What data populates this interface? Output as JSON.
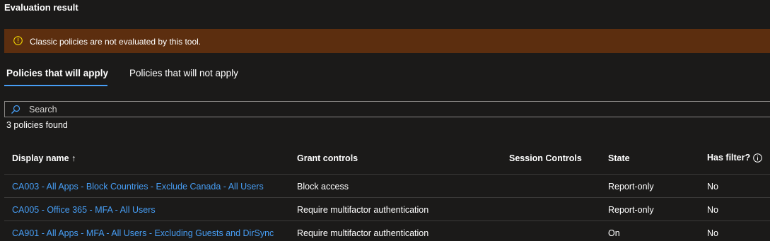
{
  "header": {
    "title": "Evaluation result"
  },
  "warning": {
    "icon": "info-icon",
    "message": "Classic policies are not evaluated by this tool.",
    "background": "#5c2e0f",
    "icon_color": "#fce100"
  },
  "tabs": [
    {
      "label": "Policies that will apply",
      "active": true
    },
    {
      "label": "Policies that will not apply",
      "active": false
    }
  ],
  "search": {
    "icon": "search-icon",
    "placeholder": "Search",
    "value": ""
  },
  "results": {
    "count_text": "3 policies found"
  },
  "table": {
    "columns": [
      {
        "label": "Display name ↑",
        "sort": "ascending"
      },
      {
        "label": "Grant controls"
      },
      {
        "label": "Session Controls"
      },
      {
        "label": "State"
      },
      {
        "label": "Has filter?",
        "icon": "info-icon"
      }
    ],
    "rows": [
      {
        "display_name": "CA003 - All Apps - Block Countries - Exclude Canada - All Users",
        "grant_controls": "Block access",
        "session_controls": "",
        "state": "Report-only",
        "has_filter": "No"
      },
      {
        "display_name": "CA005 - Office 365 - MFA - All Users",
        "grant_controls": "Require multifactor authentication",
        "session_controls": "",
        "state": "Report-only",
        "has_filter": "No"
      },
      {
        "display_name": "CA901 - All Apps - MFA - All Users - Excluding Guests and DirSync",
        "grant_controls": "Require multifactor authentication",
        "session_controls": "",
        "state": "On",
        "has_filter": "No"
      }
    ]
  },
  "colors": {
    "background": "#1b1a19",
    "accent": "#479ef5",
    "link": "#479ef5",
    "divider": "#3b3a39"
  }
}
